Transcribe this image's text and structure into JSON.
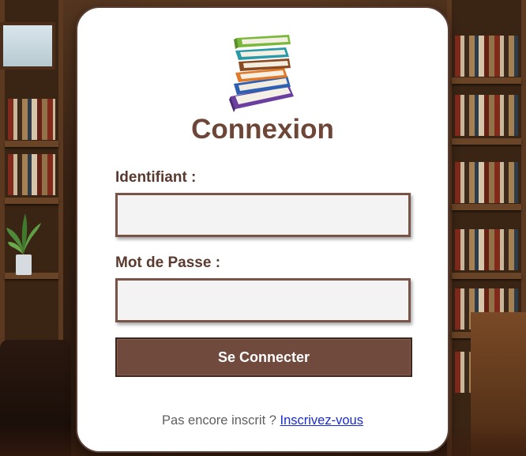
{
  "login": {
    "title": "Connexion",
    "username_label": "Identifiant :",
    "username_value": "",
    "password_label": "Mot de Passe :",
    "password_value": "",
    "submit_label": "Se Connecter",
    "footer_text": "Pas encore inscrit ?",
    "register_link": "Inscrivez-vous"
  },
  "icons": {
    "logo": "stack-of-books-icon"
  },
  "colors": {
    "accent": "#704a3d",
    "title": "#6d4637",
    "link": "#1a2bd1",
    "field_border": "#775447"
  }
}
